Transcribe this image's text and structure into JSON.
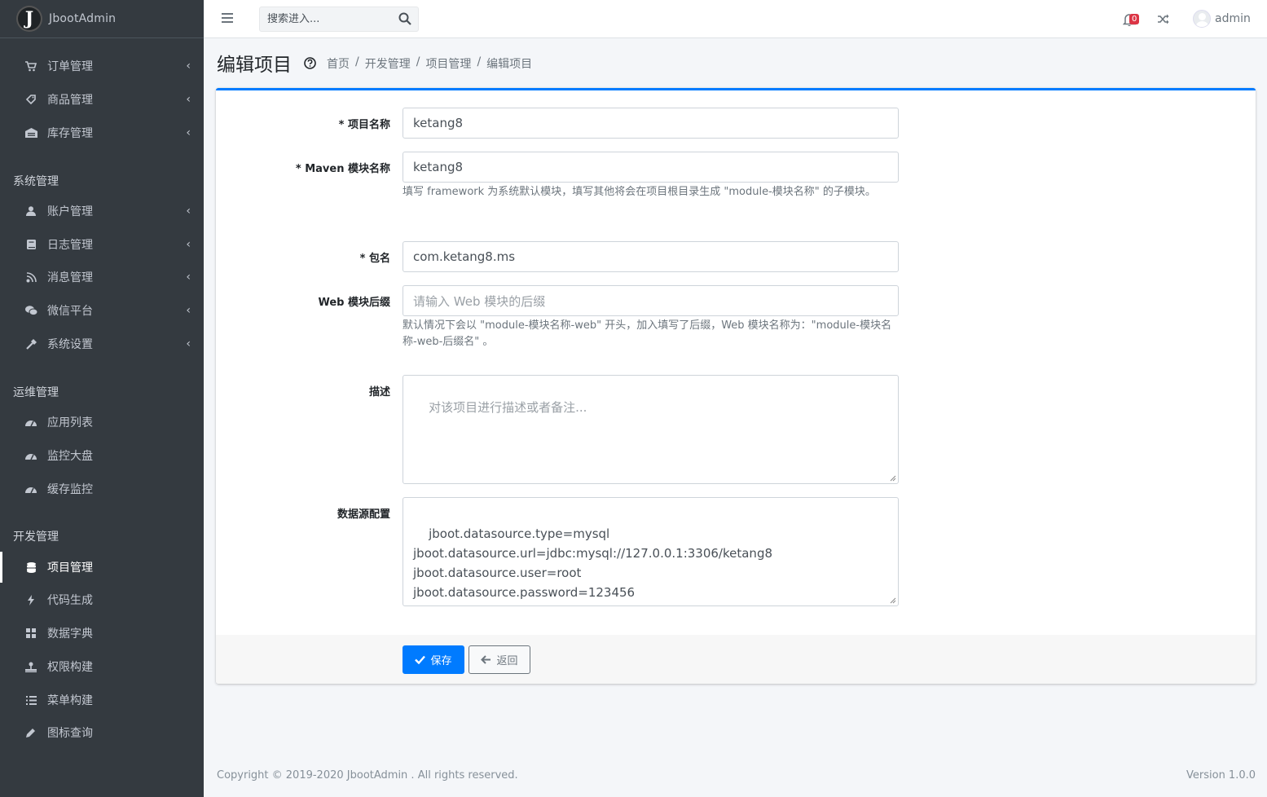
{
  "brand": {
    "logo_letter": "J",
    "name": "JbootAdmin"
  },
  "sidebar": {
    "groups": [
      {
        "header": "",
        "items": [
          {
            "label": "订单管理",
            "icon": "cart-icon",
            "has_arrow": true
          },
          {
            "label": "商品管理",
            "icon": "tag-icon",
            "has_arrow": true
          },
          {
            "label": "库存管理",
            "icon": "warehouse-icon",
            "has_arrow": true
          }
        ]
      },
      {
        "header": "系统管理",
        "items": [
          {
            "label": "账户管理",
            "icon": "user-icon",
            "has_arrow": true
          },
          {
            "label": "日志管理",
            "icon": "book-icon",
            "has_arrow": true
          },
          {
            "label": "消息管理",
            "icon": "broadcast-icon",
            "has_arrow": true
          },
          {
            "label": "微信平台",
            "icon": "wechat-icon",
            "has_arrow": true
          },
          {
            "label": "系统设置",
            "icon": "hammer-icon",
            "has_arrow": true
          }
        ]
      },
      {
        "header": "运维管理",
        "items": [
          {
            "label": "应用列表",
            "icon": "gauge-icon",
            "has_arrow": false
          },
          {
            "label": "监控大盘",
            "icon": "gauge-icon",
            "has_arrow": false
          },
          {
            "label": "缓存监控",
            "icon": "gauge-icon",
            "has_arrow": false
          }
        ]
      },
      {
        "header": "开发管理",
        "items": [
          {
            "label": "项目管理",
            "icon": "database-icon",
            "has_arrow": false,
            "active": true
          },
          {
            "label": "代码生成",
            "icon": "bolt-icon",
            "has_arrow": false
          },
          {
            "label": "数据字典",
            "icon": "grid-icon",
            "has_arrow": false
          },
          {
            "label": "权限构建",
            "icon": "sitemap-icon",
            "has_arrow": false
          },
          {
            "label": "菜单构建",
            "icon": "list-icon",
            "has_arrow": false
          },
          {
            "label": "图标查询",
            "icon": "pen-icon",
            "has_arrow": false
          }
        ]
      }
    ]
  },
  "topbar": {
    "search_placeholder": "搜索进入...",
    "notification_count": "0",
    "username": "admin"
  },
  "page": {
    "title": "编辑项目",
    "breadcrumb": [
      "首页",
      "开发管理",
      "项目管理",
      "编辑项目"
    ]
  },
  "form": {
    "project_name": {
      "label": "* 项目名称",
      "value": "ketang8"
    },
    "maven_module": {
      "label": "* Maven 模块名称",
      "value": "ketang8",
      "help": "填写 framework 为系统默认模块，填写其他将会在项目根目录生成 \"module-模块名称\" 的子模块。"
    },
    "package_name": {
      "label": "* 包名",
      "value": "com.ketang8.ms"
    },
    "web_suffix": {
      "label": "Web 模块后缀",
      "placeholder": "请输入 Web 模块的后缀",
      "help": "默认情况下会以 \"module-模块名称-web\" 开头，加入填写了后缀，Web 模块名称为：\"module-模块名称-web-后缀名\" 。"
    },
    "description": {
      "label": "描述",
      "placeholder": "对该项目进行描述或者备注..."
    },
    "datasource": {
      "label": "数据源配置",
      "value": "jboot.datasource.type=mysql\njboot.datasource.url=jdbc:mysql://127.0.0.1:3306/ketang8\njboot.datasource.user=root\njboot.datasource.password=123456"
    },
    "save_label": "保存",
    "back_label": "返回"
  },
  "footer": {
    "copyright": "Copyright © 2019-2020 JbootAdmin . All rights reserved.",
    "version": "Version 1.0.0"
  },
  "colors": {
    "primary": "#007bff",
    "sidebar_bg": "#343a40",
    "danger": "#dc3545"
  }
}
